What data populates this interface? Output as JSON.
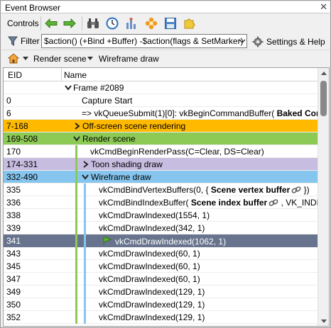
{
  "window": {
    "title": "Event Browser",
    "close_glyph": "✕"
  },
  "toolbar": {
    "label": "Controls",
    "icons": [
      "arrow-left-icon",
      "arrow-right-icon",
      "binoculars-icon",
      "clock-icon",
      "timeline-bar-icon",
      "bookmark-flower-icon",
      "save-icon",
      "export-puzzle-icon"
    ]
  },
  "filter": {
    "label": "Filter",
    "value": "$action() (+Bind +Buffer) -$action(flags & SetMarker)",
    "settings_label": "Settings & Help"
  },
  "breadcrumbs": {
    "items": [
      "Render scene",
      "Wireframe draw"
    ]
  },
  "table": {
    "columns": [
      "EID",
      "Name"
    ],
    "rows": [
      {
        "eid": "",
        "name": "Frame #2089",
        "indent": 0,
        "expander": "down",
        "style": ""
      },
      {
        "eid": "0",
        "name": "Capture Start",
        "indent": 1,
        "style": ""
      },
      {
        "eid": "6",
        "name": "=> vkQueueSubmit(1)[0]: vkBeginCommandBuffer(",
        "bold": "Baked Command Buffer",
        "indent": 1,
        "style": ""
      },
      {
        "eid": "7-168",
        "name": "Off-screen scene rendering",
        "indent": 1,
        "expander": "right",
        "style": "orange"
      },
      {
        "eid": "169-508",
        "name": "Render scene",
        "indent": 1,
        "expander": "down",
        "style": "green"
      },
      {
        "eid": "170",
        "name": "vkCmdBeginRenderPass(C=Clear, DS=Clear)",
        "indent": 2,
        "style": ""
      },
      {
        "eid": "174-331",
        "name": "Toon shading draw",
        "indent": 2,
        "expander": "right",
        "style": "purple"
      },
      {
        "eid": "332-490",
        "name": "Wireframe draw",
        "indent": 2,
        "expander": "down",
        "style": "blue"
      },
      {
        "eid": "335",
        "name": "vkCmdBindVertexBuffers(0, {",
        "bold": "Scene vertex buffer",
        "tail": "})",
        "link": true,
        "indent": 3,
        "style": ""
      },
      {
        "eid": "336",
        "name": "vkCmdBindIndexBuffer(",
        "bold": "Scene index buffer",
        "tail": ", VK_INDEX_TY",
        "link": true,
        "indent": 3,
        "style": ""
      },
      {
        "eid": "338",
        "name": "vkCmdDrawIndexed(1554, 1)",
        "indent": 3,
        "style": ""
      },
      {
        "eid": "339",
        "name": "vkCmdDrawIndexed(342, 1)",
        "indent": 3,
        "style": ""
      },
      {
        "eid": "341",
        "name": "vkCmdDrawIndexed(1062, 1)",
        "indent": 3,
        "flag": true,
        "style": "selected"
      },
      {
        "eid": "343",
        "name": "vkCmdDrawIndexed(60, 1)",
        "indent": 3,
        "style": ""
      },
      {
        "eid": "345",
        "name": "vkCmdDrawIndexed(60, 1)",
        "indent": 3,
        "style": ""
      },
      {
        "eid": "347",
        "name": "vkCmdDrawIndexed(60, 1)",
        "indent": 3,
        "style": ""
      },
      {
        "eid": "349",
        "name": "vkCmdDrawIndexed(129, 1)",
        "indent": 3,
        "style": ""
      },
      {
        "eid": "350",
        "name": "vkCmdDrawIndexed(129, 1)",
        "indent": 3,
        "style": ""
      },
      {
        "eid": "352",
        "name": "vkCmdDrawIndexed(129, 1)",
        "indent": 3,
        "style": ""
      }
    ]
  },
  "colors": {
    "marker_orange": "#ffba00",
    "marker_green": "#8dc955",
    "marker_purple": "#c7bde0",
    "marker_blue": "#86c5ee",
    "selection": "#68748d"
  }
}
